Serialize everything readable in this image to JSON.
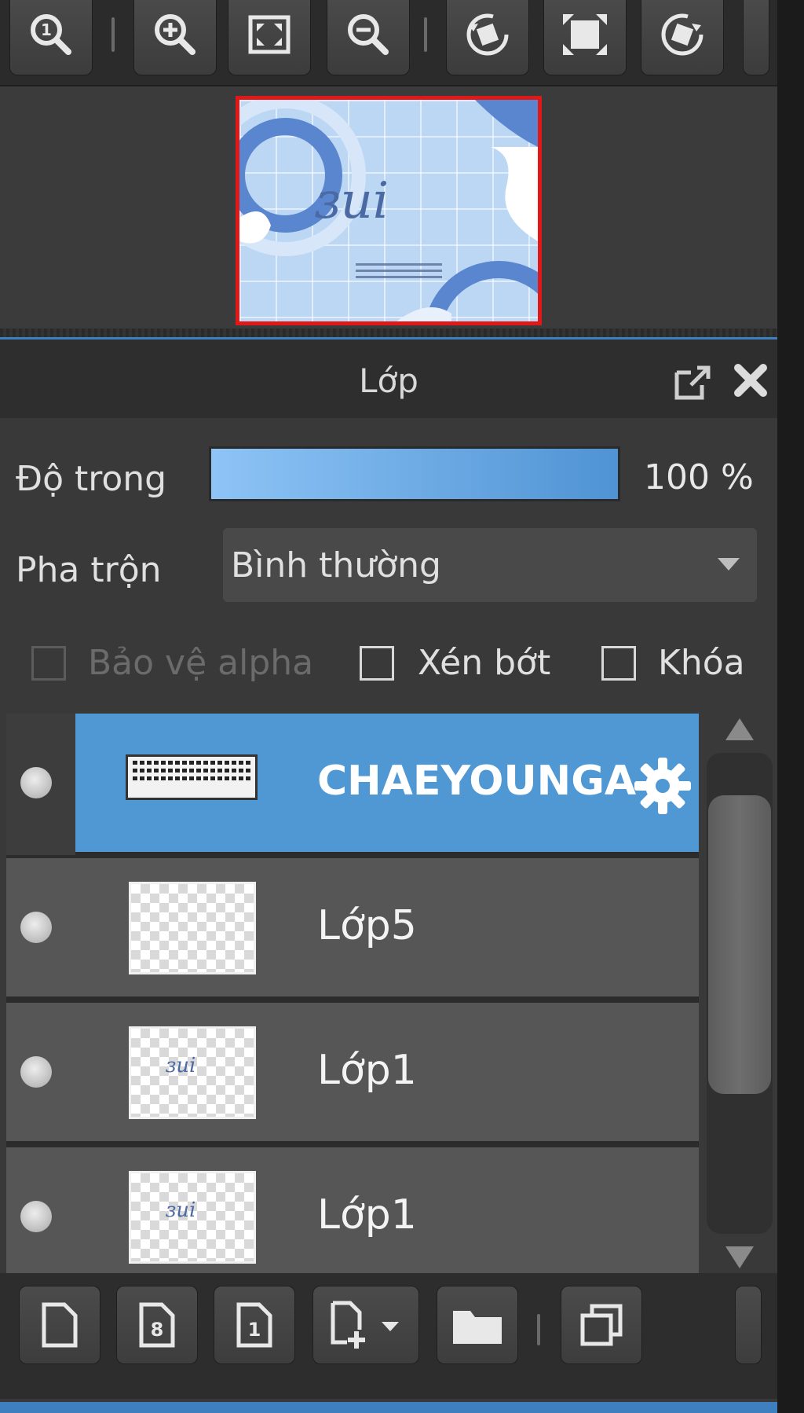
{
  "toolbar": {
    "buttons": [
      {
        "name": "zoom-actual-icon"
      },
      {
        "name": "zoom-in-icon"
      },
      {
        "name": "fit-screen-icon"
      },
      {
        "name": "zoom-out-icon"
      },
      {
        "name": "rotate-left-icon"
      },
      {
        "name": "reset-rotation-icon"
      },
      {
        "name": "rotate-right-icon"
      }
    ]
  },
  "navigator": {
    "thumbnail_text": "ɜui"
  },
  "panel": {
    "title": "Lớp"
  },
  "properties": {
    "opacity_label": "Độ trong",
    "opacity_value": "100 %",
    "opacity_fraction": 1.0,
    "blend_label": "Pha trộn",
    "blend_value": "Bình thường",
    "protect_alpha_label": "Bảo vệ alpha",
    "clipping_label": "Xén bớt",
    "lock_label": "Khóa"
  },
  "layers": [
    {
      "name": "CHAEYOUNGA",
      "selected": true,
      "thumb": "text"
    },
    {
      "name": "Lớp5",
      "selected": false,
      "thumb": "empty"
    },
    {
      "name": "Lớp1",
      "selected": false,
      "thumb": "logo",
      "thumb_text": "ɜui"
    },
    {
      "name": "Lớp1",
      "selected": false,
      "thumb": "logo",
      "thumb_text": "ɜui"
    }
  ],
  "bottom_toolbar": {
    "buttons": [
      "new-layer-icon",
      "new-8bit-layer-icon",
      "new-1bit-layer-icon",
      "add-layer-menu-icon",
      "new-folder-icon",
      "duplicate-layer-icon"
    ]
  },
  "colors": {
    "accent": "#4f98d4",
    "selection_border": "#e01818"
  }
}
